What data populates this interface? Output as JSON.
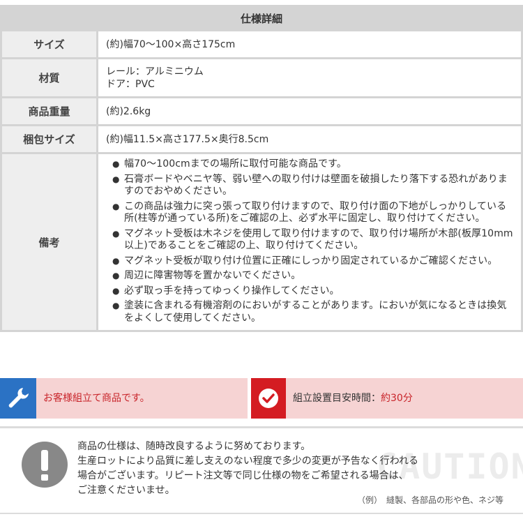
{
  "spec": {
    "caption": "仕様詳細",
    "rows": {
      "size": {
        "label": "サイズ",
        "value": "(約)幅70～100×高さ175cm"
      },
      "material": {
        "label": "材質",
        "line1": "レール：アルミニウム",
        "line2": "ドア：PVC"
      },
      "weight": {
        "label": "商品重量",
        "value": "(約)2.6kg"
      },
      "pack": {
        "label": "梱包サイズ",
        "value": "(約)幅11.5×高さ177.5×奥行8.5cm"
      },
      "notes": {
        "label": "備考",
        "items": [
          "幅70～100cmまでの場所に取付可能な商品です。",
          "石膏ボードやベニヤ等、弱い壁への取り付けは壁面を破損したり落下する恐れがありますのでおやめください。",
          "この商品は強力に突っ張って取り付けますので、取り付け面の下地がしっかりしている所(柱等が通っている所)をご確認の上、必ず水平に固定し、取り付けてください。",
          "マグネット受板は木ネジを使用して取り付けますので、取り付け場所が木部(板厚10mm以上)であることをご確認の上、取り付けてください。",
          "マグネット受板が取り付け位置に正確にしっかり固定されているかご確認ください。",
          "周辺に障害物等を置かないでください。",
          "必ず取っ手を持ってゆっくり操作してください。",
          "塗装に含まれる有機溶剤のにおいがすることがあります。においが気になるときは換気をよくして使用してください。"
        ]
      }
    }
  },
  "banners": {
    "assembly": {
      "text": "お客様組立て商品です。",
      "icon": "wrench-icon"
    },
    "time": {
      "label": "組立設置目安時間：",
      "value": "約30分",
      "icon": "clock-icon"
    }
  },
  "caution": {
    "icon": "exclamation-icon",
    "background_word": "CAUTION",
    "lines": [
      "商品の仕様は、随時改良するように努めております。",
      "生産ロットにより品質に差し支えのない程度で多少の変更が予告なく行われる",
      "場合がございます。リピート注文等で同じ仕様の物をご希望される場合は、",
      "ご注意くださいませ。"
    ],
    "example": "（例）　縫製、各部品の形や色、ネジ等"
  },
  "colors": {
    "table_border": "#d4d4d4",
    "label_bg": "#eeeeee",
    "banner_bg": "#f6d3d3",
    "wrench_bg": "#2b72c4",
    "clock_bg": "#d41c22",
    "accent_text": "#c8242a"
  }
}
